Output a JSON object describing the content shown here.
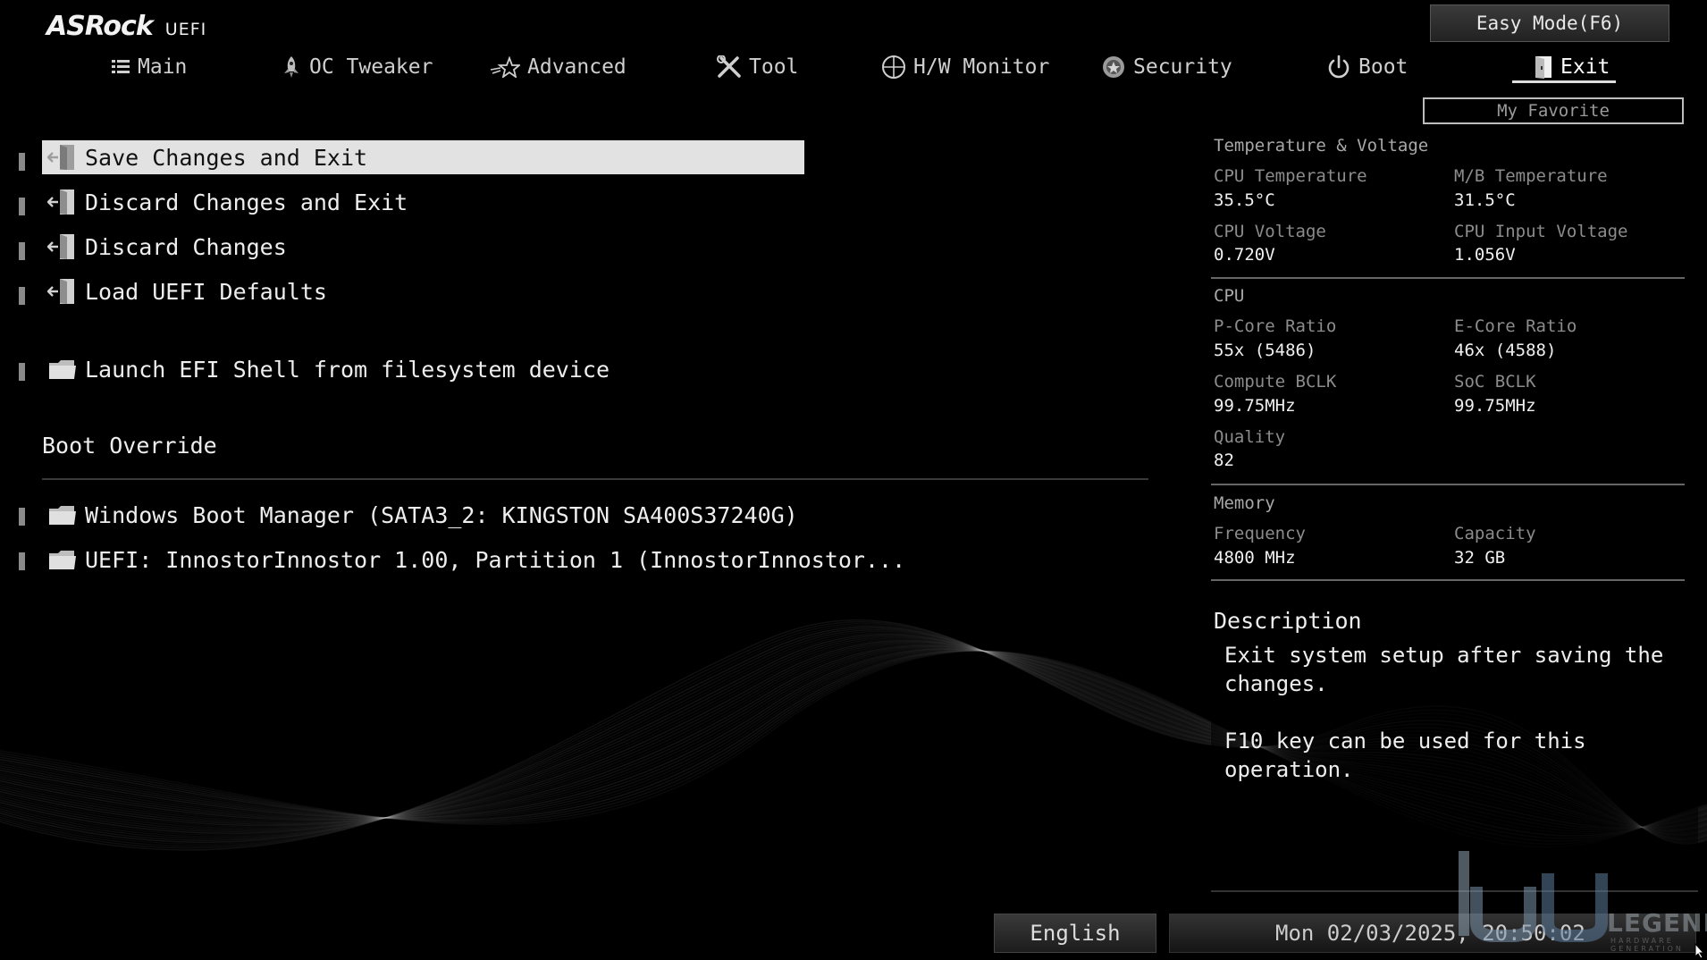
{
  "header": {
    "logo_text": "ASRock",
    "logo_sub": "UEFI",
    "easy_mode_label": "Easy Mode(F6)",
    "my_favorite_label": "My Favorite",
    "tabs": [
      {
        "label": "Main",
        "icon": "list-icon"
      },
      {
        "label": "OC Tweaker",
        "icon": "rocket-icon"
      },
      {
        "label": "Advanced",
        "icon": "star-icon"
      },
      {
        "label": "Tool",
        "icon": "tools-icon"
      },
      {
        "label": "H/W Monitor",
        "icon": "crosshair-icon"
      },
      {
        "label": "Security",
        "icon": "shield-icon"
      },
      {
        "label": "Boot",
        "icon": "power-icon"
      },
      {
        "label": "Exit",
        "icon": "exit-door-icon",
        "active": true
      }
    ]
  },
  "menu": {
    "items": [
      {
        "label": "Save Changes and Exit",
        "icon": "exit-door-icon",
        "selected": true
      },
      {
        "label": "Discard Changes and Exit",
        "icon": "exit-door-icon"
      },
      {
        "label": "Discard Changes",
        "icon": "exit-door-icon"
      },
      {
        "label": "Load UEFI Defaults",
        "icon": "exit-door-icon"
      },
      {
        "label": "Launch EFI Shell from filesystem device",
        "icon": "folder-icon"
      }
    ],
    "boot_override_label": "Boot Override",
    "boot_items": [
      {
        "label": "Windows Boot Manager (SATA3_2: KINGSTON SA400S37240G)",
        "icon": "folder-icon"
      },
      {
        "label": "UEFI: InnostorInnostor 1.00, Partition 1 (InnostorInnostor...",
        "icon": "folder-icon"
      }
    ]
  },
  "panel": {
    "temp_voltage": {
      "title": "Temperature & Voltage",
      "cpu_temp_label": "CPU Temperature",
      "cpu_temp": "35.5°C",
      "mb_temp_label": "M/B Temperature",
      "mb_temp": "31.5°C",
      "cpu_volt_label": "CPU Voltage",
      "cpu_volt": "0.720V",
      "cpu_in_volt_label": "CPU Input Voltage",
      "cpu_in_volt": "1.056V"
    },
    "cpu": {
      "title": "CPU",
      "pcore_label": "P-Core Ratio",
      "pcore": "55x (5486)",
      "ecore_label": "E-Core Ratio",
      "ecore": "46x (4588)",
      "bclk_label": "Compute BCLK",
      "bclk": "99.75MHz",
      "soc_label": "SoC BCLK",
      "soc": "99.75MHz",
      "quality_label": "Quality",
      "quality": "82"
    },
    "memory": {
      "title": "Memory",
      "freq_label": "Frequency",
      "freq": "4800 MHz",
      "cap_label": "Capacity",
      "cap": "32 GB"
    },
    "description": {
      "title": "Description",
      "line1": "Exit system setup after saving the changes.",
      "line2": "F10 key can be used for this operation."
    }
  },
  "footer": {
    "language": "English",
    "datetime": "Mon 02/03/2025, 20:50:02"
  },
  "watermark": {
    "text": "LEGEND",
    "sub": "HARDWARE GENERATION"
  }
}
